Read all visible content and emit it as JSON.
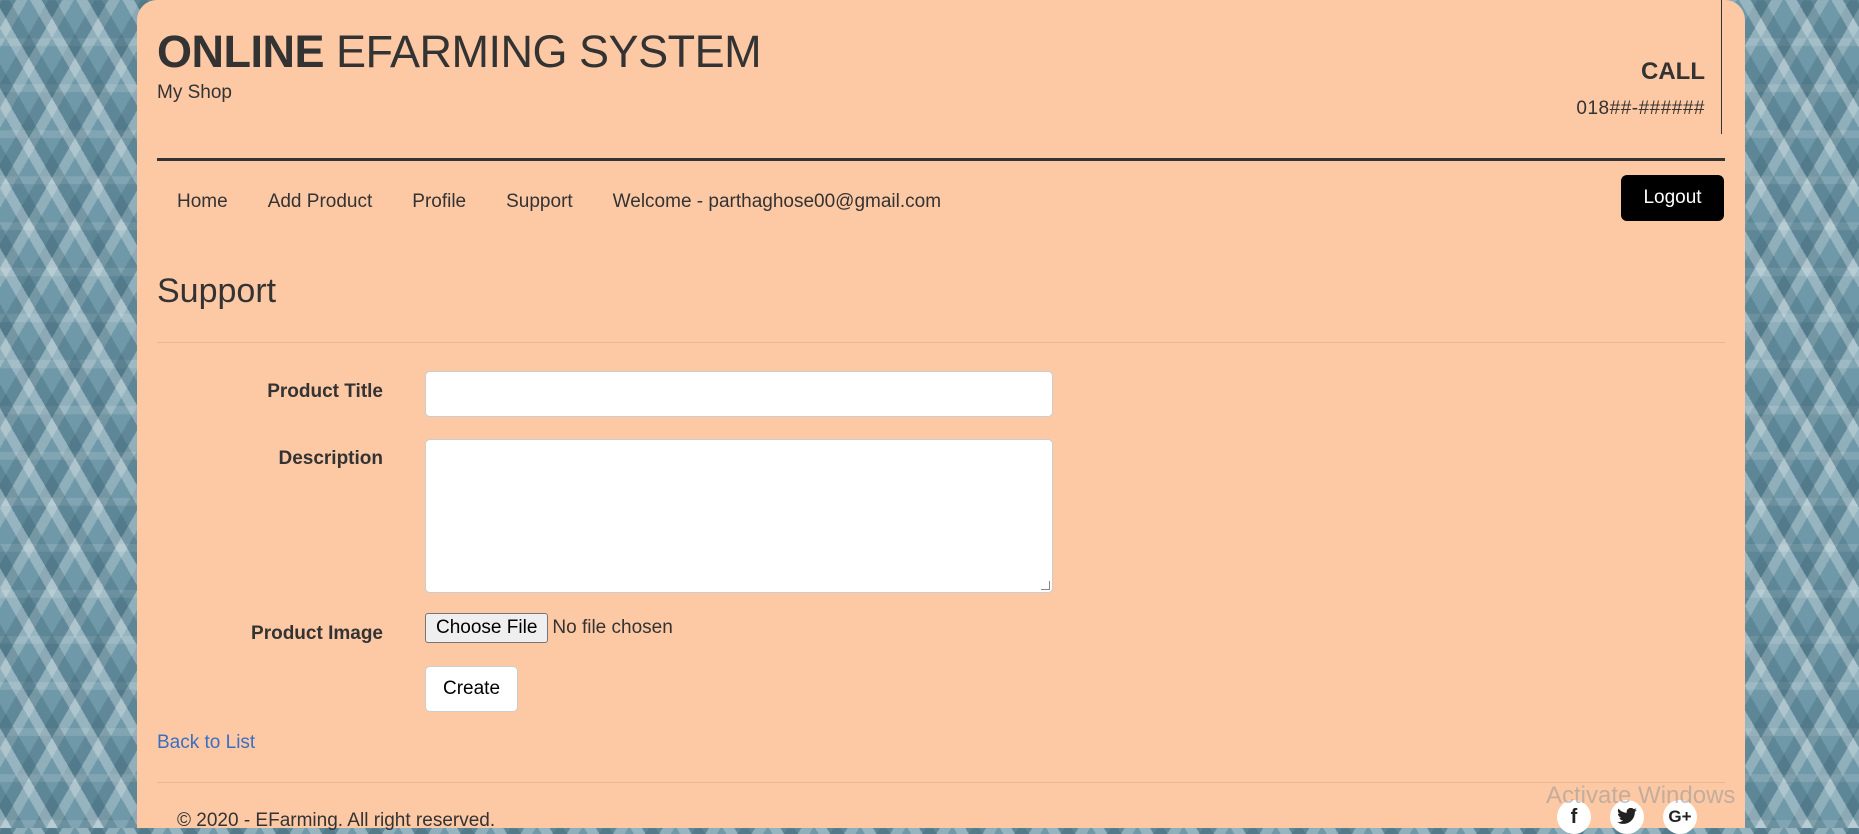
{
  "header": {
    "brand_bold": "ONLINE",
    "brand_rest": " EFARMING SYSTEM",
    "subtitle": "My Shop",
    "call_label": "CALL",
    "call_number": "018##-######"
  },
  "nav": {
    "items": [
      {
        "label": "Home"
      },
      {
        "label": "Add Product"
      },
      {
        "label": "Profile"
      },
      {
        "label": "Support"
      }
    ],
    "welcome": "Welcome - parthaghose00@gmail.com",
    "logout_label": "Logout"
  },
  "page": {
    "title": "Support"
  },
  "form": {
    "product_title_label": "Product Title",
    "product_title_value": "",
    "description_label": "Description",
    "description_value": "",
    "product_image_label": "Product Image",
    "choose_file_label": "Choose File",
    "file_status": "No file chosen",
    "create_label": "Create"
  },
  "back_link": "Back to List",
  "footer": {
    "copyright": "© 2020 - EFarming. All right reserved.",
    "social_icons": [
      "facebook-icon",
      "twitter-icon",
      "google-plus-icon"
    ]
  },
  "watermark": "Activate Windows",
  "colors": {
    "panel": "#fdc9a5",
    "logout_bg": "#000000",
    "link": "#3a6ec4"
  }
}
